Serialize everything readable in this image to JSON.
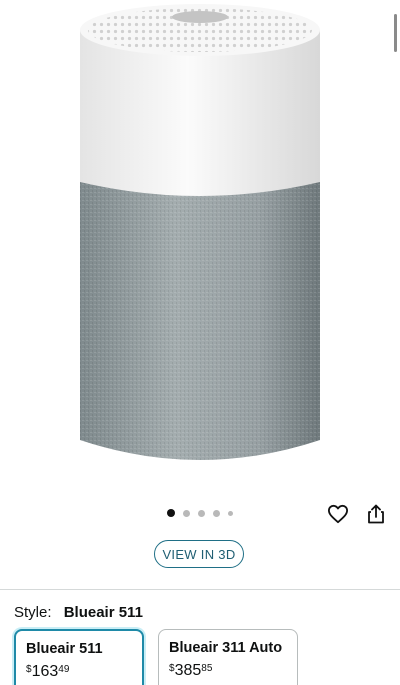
{
  "gallery": {
    "dot_count": 5,
    "active_index": 0
  },
  "actions": {
    "favorite_icon": "heart-outline-icon",
    "share_icon": "share-icon",
    "view_3d_label": "VIEW IN 3D"
  },
  "style_selector": {
    "label": "Style:",
    "selected_value": "Blueair 511",
    "options": [
      {
        "name": "Blueair 511",
        "price_symbol": "$",
        "price_whole": "163",
        "price_fraction": "49",
        "selected": true
      },
      {
        "name": "Blueair 311 Auto",
        "price_symbol": "$",
        "price_whole": "385",
        "price_fraction": "85",
        "selected": false
      }
    ]
  },
  "colors": {
    "accent": "#1f8aa8",
    "button_text": "#1f5e72",
    "fabric": "#9aa5a8",
    "top_shell": "#f2f2f2"
  }
}
